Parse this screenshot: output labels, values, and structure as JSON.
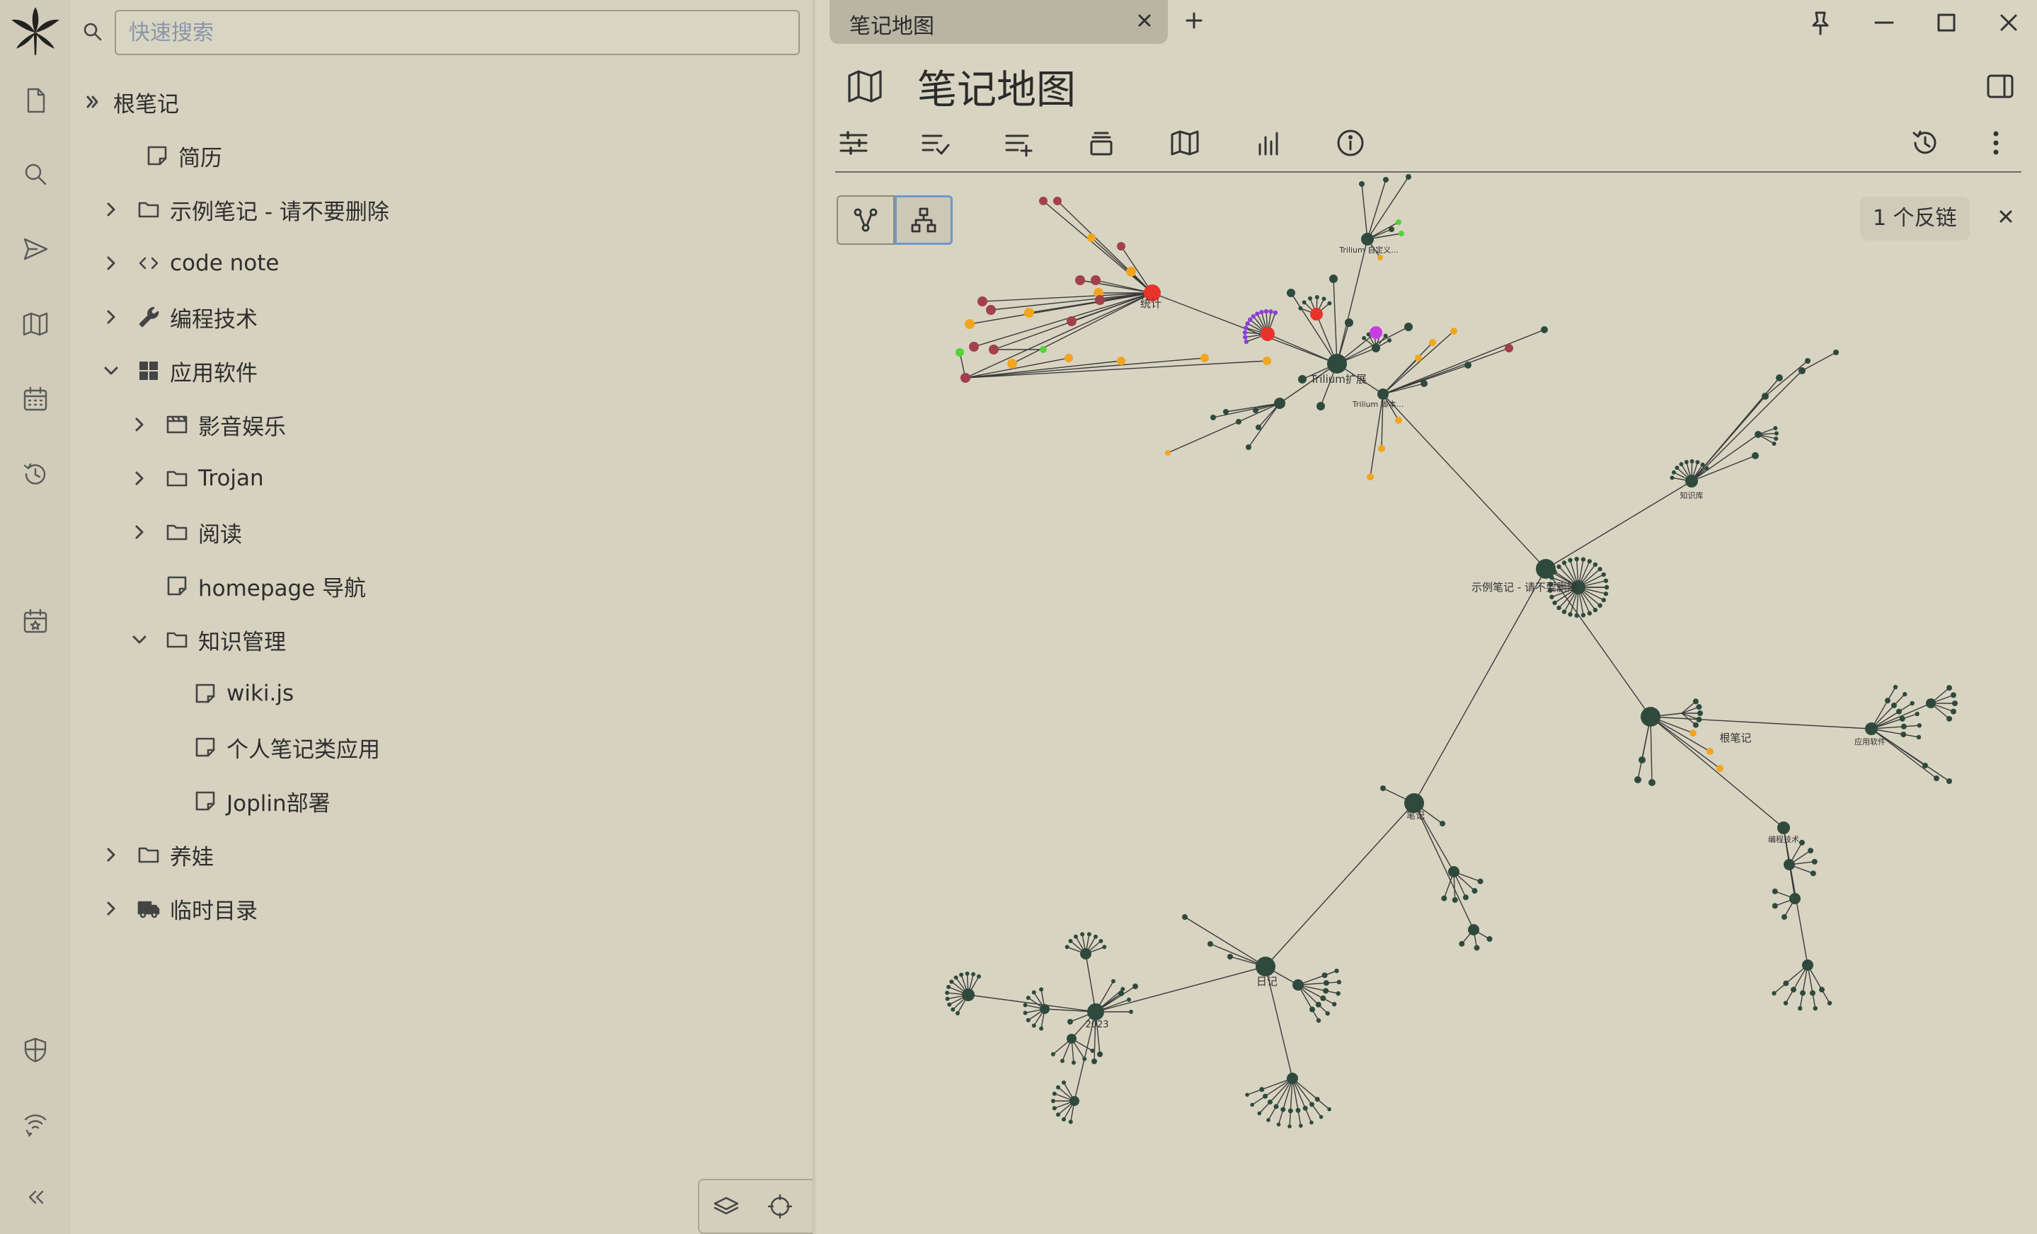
{
  "search": {
    "placeholder": "快速搜索"
  },
  "tree": {
    "root": "根笔记",
    "items": [
      {
        "label": "简历"
      },
      {
        "label": "示例笔记 - 请不要删除"
      },
      {
        "label": "code note"
      },
      {
        "label": "编程技术"
      },
      {
        "label": "应用软件"
      },
      {
        "label": "影音娱乐"
      },
      {
        "label": "Trojan"
      },
      {
        "label": "阅读"
      },
      {
        "label": "homepage 导航"
      },
      {
        "label": "知识管理"
      },
      {
        "label": "wiki.js"
      },
      {
        "label": "个人笔记类应用"
      },
      {
        "label": "Joplin部署"
      },
      {
        "label": "养娃"
      },
      {
        "label": "临时目录"
      }
    ]
  },
  "tab": {
    "title": "笔记地图"
  },
  "note": {
    "title": "笔记地图"
  },
  "backlinks": {
    "label": "1 个反链"
  },
  "map_labels": {
    "stats": "统计",
    "trilium_ext": "Trilium扩展",
    "trilium_custom": "Trilium 自定义...",
    "trilium_script": "Trilium 脚本...",
    "examples": "示例笔记 - 请不要删除",
    "knowledge": "知识库",
    "root": "根笔记",
    "apps": "应用软件",
    "prog": "编程技术",
    "notes": "笔记",
    "diary": "日记",
    "year": "2023"
  },
  "colors": {
    "node_default": "#2f4a3d",
    "node_red": "#e8332a",
    "node_maroon": "#a2404b",
    "node_orange": "#f2a51f",
    "node_green": "#56d23a",
    "node_purple": "#8a3fd6",
    "node_magenta": "#c73de0"
  }
}
